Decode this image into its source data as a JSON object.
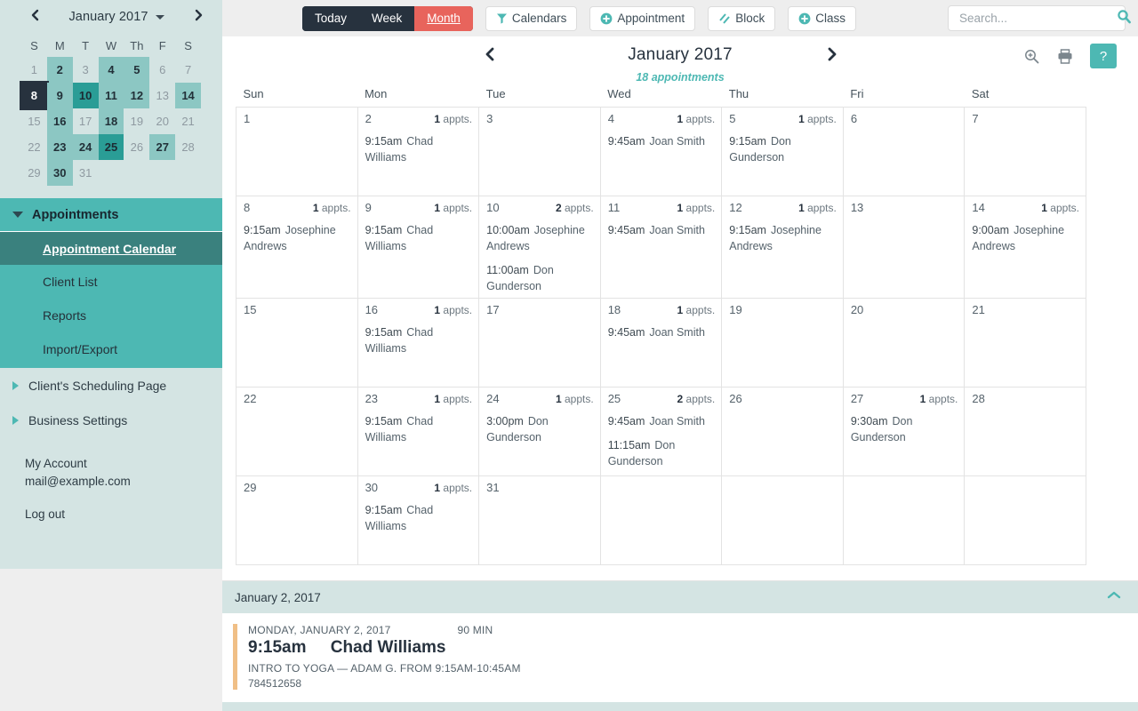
{
  "sidebar": {
    "collapse_icon": "chevron-left-icon",
    "mini_calendar": {
      "title": "January 2017",
      "prev_icon": "chevron-left-icon",
      "next_icon": "chevron-right-icon",
      "dropdown_icon": "caret-down-icon",
      "dow": [
        "S",
        "M",
        "T",
        "W",
        "Th",
        "F",
        "S"
      ],
      "days": [
        {
          "n": "1",
          "hl": "none"
        },
        {
          "n": "2",
          "hl": "lvl1"
        },
        {
          "n": "3",
          "hl": "none"
        },
        {
          "n": "4",
          "hl": "lvl1"
        },
        {
          "n": "5",
          "hl": "lvl1"
        },
        {
          "n": "6",
          "hl": "none"
        },
        {
          "n": "7",
          "hl": "none"
        },
        {
          "n": "8",
          "hl": "sel"
        },
        {
          "n": "9",
          "hl": "lvl1"
        },
        {
          "n": "10",
          "hl": "lvl2"
        },
        {
          "n": "11",
          "hl": "lvl1"
        },
        {
          "n": "12",
          "hl": "lvl1"
        },
        {
          "n": "13",
          "hl": "none"
        },
        {
          "n": "14",
          "hl": "lvl1"
        },
        {
          "n": "15",
          "hl": "none"
        },
        {
          "n": "16",
          "hl": "lvl1"
        },
        {
          "n": "17",
          "hl": "none"
        },
        {
          "n": "18",
          "hl": "lvl1"
        },
        {
          "n": "19",
          "hl": "none"
        },
        {
          "n": "20",
          "hl": "none"
        },
        {
          "n": "21",
          "hl": "none"
        },
        {
          "n": "22",
          "hl": "none"
        },
        {
          "n": "23",
          "hl": "lvl1"
        },
        {
          "n": "24",
          "hl": "lvl1"
        },
        {
          "n": "25",
          "hl": "lvl2"
        },
        {
          "n": "26",
          "hl": "none"
        },
        {
          "n": "27",
          "hl": "lvl1"
        },
        {
          "n": "28",
          "hl": "none"
        },
        {
          "n": "29",
          "hl": "none"
        },
        {
          "n": "30",
          "hl": "lvl1"
        },
        {
          "n": "31",
          "hl": "none"
        }
      ]
    },
    "appointments_group": {
      "label": "Appointments",
      "expanded_icon": "chevron-down-icon",
      "items": [
        {
          "label": "Appointment Calendar",
          "active": true
        },
        {
          "label": "Client List",
          "active": false
        },
        {
          "label": "Reports",
          "active": false
        },
        {
          "label": "Import/Export",
          "active": false
        }
      ]
    },
    "top_items": [
      {
        "label": "Client's Scheduling Page",
        "icon": "chevron-right-icon"
      },
      {
        "label": "Business Settings",
        "icon": "chevron-right-icon"
      }
    ],
    "account": {
      "my_account": "My Account",
      "email": "mail@example.com",
      "logout": "Log out"
    }
  },
  "toolbar": {
    "views": [
      {
        "label": "Today",
        "active": false
      },
      {
        "label": "Week",
        "active": false
      },
      {
        "label": "Month",
        "active": true
      }
    ],
    "buttons": [
      {
        "label": "Calendars",
        "icon": "filter-icon"
      },
      {
        "label": "Appointment",
        "icon": "plus-circle-icon"
      },
      {
        "label": "Block",
        "icon": "hatch-icon"
      },
      {
        "label": "Class",
        "icon": "plus-circle-icon"
      }
    ],
    "search": {
      "placeholder": "Search...",
      "value": "",
      "icon": "search-icon"
    }
  },
  "calendar": {
    "month_title": "January 2017",
    "appointment_summary": "18 appointments",
    "prev_icon": "chevron-left-icon",
    "next_icon": "chevron-right-icon",
    "head_icons": [
      {
        "name": "zoom-in-icon"
      },
      {
        "name": "print-icon"
      },
      {
        "name": "help-button",
        "label": "?"
      }
    ],
    "day_headers": [
      "Sun",
      "Mon",
      "Tue",
      "Wed",
      "Thu",
      "Fri",
      "Sat"
    ],
    "appts_suffix": "appts.",
    "weeks": [
      [
        {
          "day": "1",
          "count": "",
          "appts": []
        },
        {
          "day": "2",
          "count": "1",
          "appts": [
            {
              "time": "9:15am",
              "name": "Chad Williams"
            }
          ]
        },
        {
          "day": "3",
          "count": "",
          "appts": []
        },
        {
          "day": "4",
          "count": "1",
          "appts": [
            {
              "time": "9:45am",
              "name": "Joan Smith"
            }
          ]
        },
        {
          "day": "5",
          "count": "1",
          "appts": [
            {
              "time": "9:15am",
              "name": "Don Gunderson"
            }
          ]
        },
        {
          "day": "6",
          "count": "",
          "appts": []
        },
        {
          "day": "7",
          "count": "",
          "appts": []
        }
      ],
      [
        {
          "day": "8",
          "count": "1",
          "appts": [
            {
              "time": "9:15am",
              "name": "Josephine Andrews"
            }
          ]
        },
        {
          "day": "9",
          "count": "1",
          "appts": [
            {
              "time": "9:15am",
              "name": "Chad Williams"
            }
          ]
        },
        {
          "day": "10",
          "count": "2",
          "appts": [
            {
              "time": "10:00am",
              "name": "Josephine Andrews"
            },
            {
              "time": "11:00am",
              "name": "Don Gunderson"
            }
          ]
        },
        {
          "day": "11",
          "count": "1",
          "appts": [
            {
              "time": "9:45am",
              "name": "Joan Smith"
            }
          ]
        },
        {
          "day": "12",
          "count": "1",
          "appts": [
            {
              "time": "9:15am",
              "name": "Josephine Andrews"
            }
          ]
        },
        {
          "day": "13",
          "count": "",
          "appts": []
        },
        {
          "day": "14",
          "count": "1",
          "appts": [
            {
              "time": "9:00am",
              "name": "Josephine Andrews"
            }
          ]
        }
      ],
      [
        {
          "day": "15",
          "count": "",
          "appts": []
        },
        {
          "day": "16",
          "count": "1",
          "appts": [
            {
              "time": "9:15am",
              "name": "Chad Williams"
            }
          ]
        },
        {
          "day": "17",
          "count": "",
          "appts": []
        },
        {
          "day": "18",
          "count": "1",
          "appts": [
            {
              "time": "9:45am",
              "name": "Joan Smith"
            }
          ]
        },
        {
          "day": "19",
          "count": "",
          "appts": []
        },
        {
          "day": "20",
          "count": "",
          "appts": []
        },
        {
          "day": "21",
          "count": "",
          "appts": []
        }
      ],
      [
        {
          "day": "22",
          "count": "",
          "appts": []
        },
        {
          "day": "23",
          "count": "1",
          "appts": [
            {
              "time": "9:15am",
              "name": "Chad Williams"
            }
          ]
        },
        {
          "day": "24",
          "count": "1",
          "appts": [
            {
              "time": "3:00pm",
              "name": "Don Gunderson"
            }
          ]
        },
        {
          "day": "25",
          "count": "2",
          "appts": [
            {
              "time": "9:45am",
              "name": "Joan Smith"
            },
            {
              "time": "11:15am",
              "name": "Don Gunderson"
            }
          ]
        },
        {
          "day": "26",
          "count": "",
          "appts": []
        },
        {
          "day": "27",
          "count": "1",
          "appts": [
            {
              "time": "9:30am",
              "name": "Don Gunderson"
            }
          ]
        },
        {
          "day": "28",
          "count": "",
          "appts": []
        }
      ],
      [
        {
          "day": "29",
          "count": "",
          "appts": []
        },
        {
          "day": "30",
          "count": "1",
          "appts": [
            {
              "time": "9:15am",
              "name": "Chad Williams"
            }
          ]
        },
        {
          "day": "31",
          "count": "",
          "appts": []
        },
        {
          "day": "",
          "count": "",
          "appts": []
        },
        {
          "day": "",
          "count": "",
          "appts": []
        },
        {
          "day": "",
          "count": "",
          "appts": []
        },
        {
          "day": "",
          "count": "",
          "appts": []
        }
      ]
    ]
  },
  "detail_panel": {
    "title": "January 2, 2017",
    "collapse_icon": "chevron-up-icon",
    "appointment": {
      "date_line": "MONDAY, JANUARY 2, 2017",
      "duration": "90 MIN",
      "time": "9:15am",
      "client": "Chad Williams",
      "description": "INTRO TO YOGA — ADAM G. FROM 9:15AM-10:45AM",
      "code": "784512658",
      "accent_color": "#f0bf86"
    }
  },
  "colors": {
    "accent_teal": "#4db8b3",
    "sidebar_bg": "#d4e4e3",
    "dark_navy": "#27323e",
    "active_red": "#e8645c"
  }
}
